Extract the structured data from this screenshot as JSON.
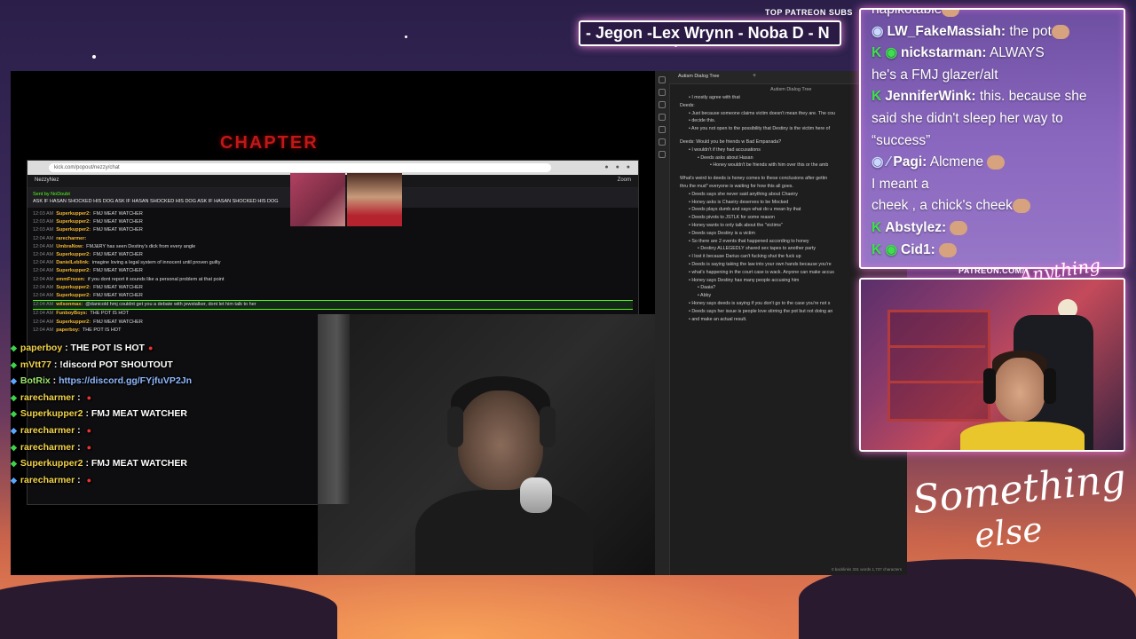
{
  "top_patreon": {
    "label": "TOP PATREON SUBS",
    "ticker": "- Jegon -Lex Wrynn -  Noba D - N"
  },
  "game": {
    "title": "CHAPTER"
  },
  "browser": {
    "url": "kick.com/popout/nezzy/chat",
    "channel": "NezzyNez",
    "zoom_label": "Zoom",
    "pinned_by": "Sent by NoDoubt",
    "pinned_text": "ASK IF HASAN SHOCKED HIS DOG  ASK IF HASAN SHOCKED HIS DOG  ASK IF HASAN SHOCKED HIS DOG",
    "chat": [
      {
        "time": "12:03 AM",
        "user": "Superkupper2:",
        "msg": "FMJ MEAT WATCHER"
      },
      {
        "time": "12:03 AM",
        "user": "Superkupper2:",
        "msg": "FMJ MEAT WATCHER"
      },
      {
        "time": "12:03 AM",
        "user": "Superkupper2:",
        "msg": "FMJ MEAT WATCHER"
      },
      {
        "time": "12:04 AM",
        "user": "rarecharmer:",
        "msg": ""
      },
      {
        "time": "12:04 AM",
        "user": "UmbraNow:",
        "msg": "FMJ&RY has seen Destiny's dick from every angle"
      },
      {
        "time": "12:04 AM",
        "user": "Superkupper2:",
        "msg": "FMJ MEAT WATCHER"
      },
      {
        "time": "12:04 AM",
        "user": "DanielLeblink:",
        "msg": "imagine loving a legal system of innocent until proven guilty"
      },
      {
        "time": "12:04 AM",
        "user": "Superkupper2:",
        "msg": "FMJ MEAT WATCHER"
      },
      {
        "time": "12:04 AM",
        "user": "emmFrozen:",
        "msg": "if you dont report it sounds like a personal problem at that point"
      },
      {
        "time": "12:04 AM",
        "user": "Superkupper2:",
        "msg": "FMJ MEAT WATCHER"
      },
      {
        "time": "12:04 AM",
        "user": "Superkupper2:",
        "msg": "FMJ MEAT WATCHER"
      },
      {
        "time": "12:04 AM",
        "user": "wilsonmax:",
        "msg": "@danicold hmj couldnt get you a debate with jewstalker, dont let him talk to her"
      },
      {
        "time": "12:04 AM",
        "user": "FunboyBoys:",
        "msg": "THE POT IS HOT"
      },
      {
        "time": "12:04 AM",
        "user": "Superkupper2:",
        "msg": "FMJ MEAT WATCHER"
      },
      {
        "time": "12:04 AM",
        "user": "paperboy:",
        "msg": "THE POT IS HOT"
      }
    ]
  },
  "overlay_chat": [
    {
      "user": "paperboy",
      "sep": " : ",
      "msg": "THE POT IS HOT",
      "link": false
    },
    {
      "user": "mVtt77",
      "sep": " : ",
      "msg": "!discord POT SHOUTOUT",
      "link": false
    },
    {
      "user": "BotRix",
      "sep": " : ",
      "msg": "https://discord.gg/FYjfuVP2Jn",
      "link": true
    },
    {
      "user": "rarecharmer",
      "sep": " : ",
      "msg": "",
      "link": false
    },
    {
      "user": "Superkupper2",
      "sep": " : ",
      "msg": "FMJ MEAT WATCHER",
      "link": false
    },
    {
      "user": "rarecharmer",
      "sep": " : ",
      "msg": "",
      "link": false
    },
    {
      "user": "rarecharmer",
      "sep": " : ",
      "msg": "",
      "link": false
    },
    {
      "user": "Superkupper2",
      "sep": " : ",
      "msg": "FMJ MEAT WATCHER",
      "link": false
    },
    {
      "user": "rarecharmer",
      "sep": " : ",
      "msg": "",
      "link": false
    }
  ],
  "notes": {
    "tab": "Autism Dialog Tree",
    "title": "Autism Dialog Tree",
    "status": "0 backlinks   331 words  1,737 characters",
    "lines": [
      {
        "indent": 1,
        "text": "I mostly agree with that",
        "gap": false
      },
      {
        "indent": 0,
        "text": "Deeds:",
        "gap": false
      },
      {
        "indent": 1,
        "text": "Just because someone claims victim doesn't mean they are. The cou",
        "gap": false
      },
      {
        "indent": 1,
        "text": "decide this.",
        "gap": false
      },
      {
        "indent": 1,
        "text": "Are you not open to the possibility that Destiny is the victim here of",
        "gap": false
      },
      {
        "indent": 0,
        "text": "Deeds: Would you be friends w Bad Empanada?",
        "gap": true
      },
      {
        "indent": 1,
        "text": "I wouldn't if they had accusations",
        "gap": false
      },
      {
        "indent": 2,
        "text": "Deeds asks about Hasan",
        "gap": false
      },
      {
        "indent": 3,
        "text": "Honey wouldn't be friends with him over this or the amb",
        "gap": false
      },
      {
        "indent": 0,
        "text": "What's weird to deeds is honey comes to these conclusions after gettin",
        "gap": true
      },
      {
        "indent": 0,
        "text": "thru the mud\" everyone is waiting for how this all goes.",
        "gap": false
      },
      {
        "indent": 1,
        "text": "Deeds says she never said anything about Chaeiry",
        "gap": false
      },
      {
        "indent": 1,
        "text": "Honey asks is Chaeiry deserves to be Mocked",
        "gap": false
      },
      {
        "indent": 1,
        "text": "Deeds plays dumb and says what do u mean by that",
        "gap": false
      },
      {
        "indent": 1,
        "text": "Deeds pivots to JSTLK for some reason",
        "gap": false
      },
      {
        "indent": 1,
        "text": "Honey wants to only talk about the \"victims\"",
        "gap": false
      },
      {
        "indent": 1,
        "text": "Deeds says Destiny is a victim",
        "gap": false
      },
      {
        "indent": 1,
        "text": "So there are 2 events that happened according to honey",
        "gap": false
      },
      {
        "indent": 2,
        "text": "Destiny ALLEGEDLY shared sex tapes to another party",
        "gap": false
      },
      {
        "indent": 1,
        "text": "I lost it because Darius can't fucking shut the fuck up",
        "gap": false
      },
      {
        "indent": 1,
        "text": "Deeds is saying taking the law into your own hands because you're",
        "gap": false
      },
      {
        "indent": 1,
        "text": "what's happening in the court case is wack. Anyone can make accus",
        "gap": false
      },
      {
        "indent": 1,
        "text": "Honey says Destiny has many people accusing him",
        "gap": false
      },
      {
        "indent": 2,
        "text": "Daaia?",
        "gap": false
      },
      {
        "indent": 2,
        "text": "Abby",
        "gap": false
      },
      {
        "indent": 1,
        "text": "Honey says deeds is saying if you don't go to the case you're not s",
        "gap": false
      },
      {
        "indent": 1,
        "text": "Deeds says her issue is people love stirring the pot but not doing an",
        "gap": false
      },
      {
        "indent": 1,
        "text": "and make an actual result.",
        "gap": false
      }
    ]
  },
  "chat_panel": {
    "lines": [
      {
        "badge": "",
        "user": "",
        "msg": "hapikotable",
        "emote": true
      },
      {
        "badge": "◉",
        "user": "LW_FakeMassiah:",
        "msg": " the pot",
        "emote": true
      },
      {
        "badge": "K ◉",
        "user": "nickstarman:",
        "msg": " ALWAYS",
        "emote": false
      },
      {
        "badge": "",
        "user": "",
        "msg": "he's a FMJ glazer/alt",
        "emote": false
      },
      {
        "badge": "K",
        "user": "JenniferWink:",
        "msg": " this. because she",
        "emote": false
      },
      {
        "badge": "",
        "user": "",
        "msg": "said she didn't sleep her way to",
        "emote": false
      },
      {
        "badge": "",
        "user": "",
        "msg": "“success”",
        "emote": false
      },
      {
        "badge": "◉ ⁄",
        "user": "Pagi:",
        "msg": " Alcmene ",
        "emote": true
      },
      {
        "badge": "",
        "user": "",
        "msg": " I meant a",
        "emote": false
      },
      {
        "badge": "",
        "user": "",
        "msg": "cheek , a chick's cheek",
        "emote": true
      },
      {
        "badge": "K",
        "user": "Abstylez:",
        "msg": " ",
        "emote": true
      },
      {
        "badge": "K ◉",
        "user": "Cid1:",
        "msg": " ",
        "emote": true
      }
    ]
  },
  "patreon_url": "PATREON.COM/",
  "logo": {
    "small": "Anything else",
    "line1": "Something",
    "line2": "else"
  },
  "colors": {
    "accent_glow": "#ff78e6",
    "kick_green": "#53fc18",
    "chat_panel_bg": "#8a67bf"
  }
}
